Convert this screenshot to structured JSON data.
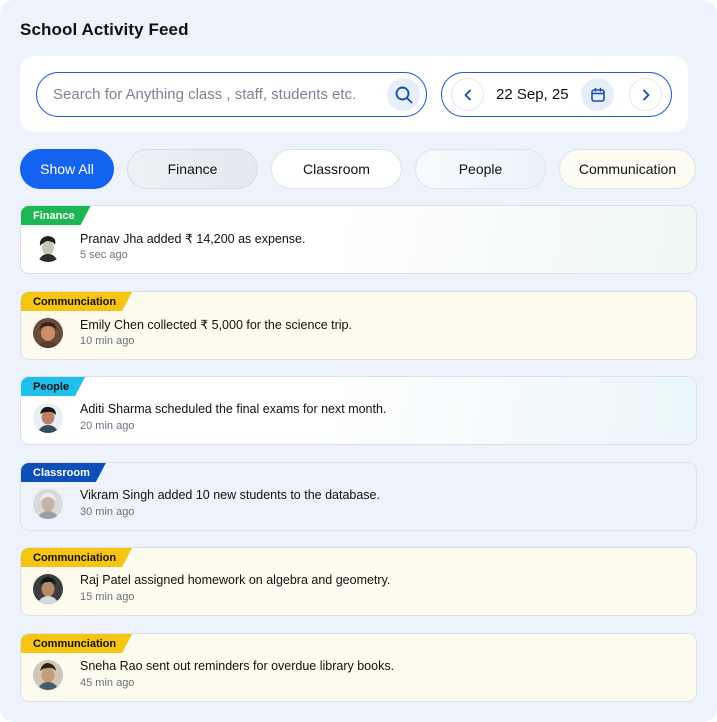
{
  "page_title": "School Activity Feed",
  "search": {
    "placeholder": "Search for Anything class , staff, students etc.",
    "icon": "search-icon"
  },
  "date_picker": {
    "value": "22 Sep, 25",
    "prev_icon": "chevron-left-icon",
    "next_icon": "chevron-right-icon",
    "calendar_icon": "calendar-icon"
  },
  "filters": [
    {
      "label": "Show All",
      "active": true
    },
    {
      "label": "Finance",
      "active": false
    },
    {
      "label": "Classroom",
      "active": false
    },
    {
      "label": "People",
      "active": false
    },
    {
      "label": "Communication",
      "active": false
    }
  ],
  "colors": {
    "accent": "#1362f0",
    "finance_tag": "#1cb752",
    "communication_tag": "#f6c514",
    "people_tag": "#1fc0ea",
    "classroom_tag": "#0c4fb8"
  },
  "feed": [
    {
      "tag": "Finance",
      "message": "Pranav Jha added ₹ 14,200 as expense.",
      "time": "5 sec ago"
    },
    {
      "tag": "Communciation",
      "message": "Emily Chen collected ₹ 5,000 for the science trip.",
      "time": "10 min ago"
    },
    {
      "tag": "People",
      "message": "Aditi Sharma scheduled the final exams for next month.",
      "time": "20 min ago"
    },
    {
      "tag": "Classroom",
      "message": "Vikram Singh added 10 new students to the database.",
      "time": "30 min ago"
    },
    {
      "tag": "Communciation",
      "message": "Raj Patel assigned homework on algebra and geometry.",
      "time": "15 min ago"
    },
    {
      "tag": "Communciation",
      "message": "Sneha Rao sent out reminders for overdue library books.",
      "time": "45 min ago"
    }
  ]
}
